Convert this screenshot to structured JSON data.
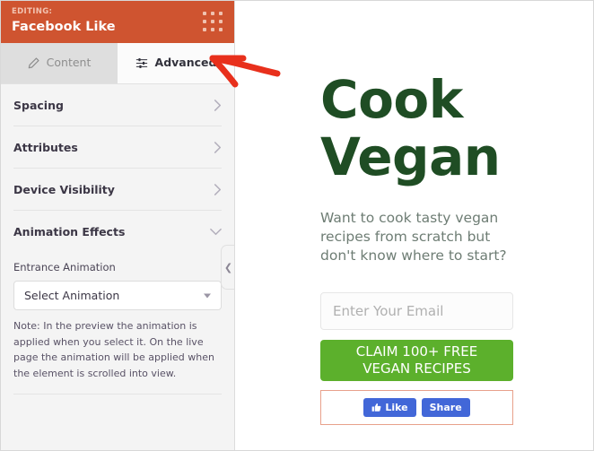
{
  "sidebar": {
    "header": {
      "editing_label": "EDITING:",
      "title": "Facebook Like",
      "drag_handle_icon": "grid-dots-icon"
    },
    "tabs": [
      {
        "label": "Content",
        "icon": "pencil-icon",
        "active": false
      },
      {
        "label": "Advanced",
        "icon": "sliders-icon",
        "active": true
      }
    ],
    "sections": [
      {
        "label": "Spacing",
        "state": "collapsed",
        "chevron": "chevron-right-icon"
      },
      {
        "label": "Attributes",
        "state": "collapsed",
        "chevron": "chevron-right-icon"
      },
      {
        "label": "Device Visibility",
        "state": "collapsed",
        "chevron": "chevron-right-icon"
      },
      {
        "label": "Animation Effects",
        "state": "expanded",
        "chevron": "chevron-down-icon"
      }
    ],
    "animation_panel": {
      "field_label": "Entrance Animation",
      "select_value": "Select Animation",
      "select_caret_icon": "caret-down-icon",
      "note": "Note: In the preview the animation is applied when you select it. On the live page the animation will be applied when the element is scrolled into view."
    },
    "collapse_toggle": {
      "icon": "chevron-left-icon"
    }
  },
  "preview": {
    "heading": "Cook Vegan",
    "subheading": "Want to cook tasty vegan recipes from scratch but don't know where to start?",
    "email_field": {
      "value": "",
      "placeholder": "Enter Your Email"
    },
    "cta_button": {
      "line1": "CLAIM 100+ FREE",
      "line2": "VEGAN RECIPES"
    },
    "facebook_widget": {
      "like_label": "Like",
      "like_icon": "thumbs-up-icon",
      "share_label": "Share",
      "selected": true
    }
  },
  "annotation": {
    "arrow_icon": "arrow-left-icon"
  },
  "colors": {
    "panel_header_orange": "#cf5430",
    "tab_active_bg": "#fbfbfb",
    "tab_inactive_bg": "#dedede",
    "heading_green": "#1f4d24",
    "cta_green": "#5cb02c",
    "facebook_blue": "#4267d8",
    "highlight_border": "#e8a18b",
    "annotation_red": "#e8301c"
  }
}
